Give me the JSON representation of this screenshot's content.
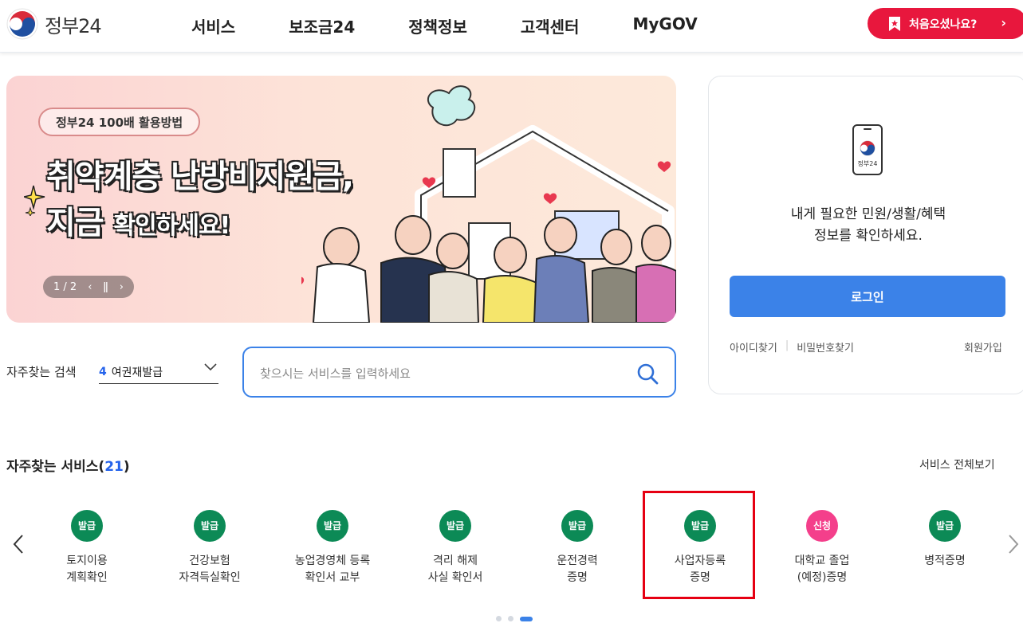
{
  "header": {
    "logo_text": "정부24",
    "nav": [
      "서비스",
      "보조금24",
      "정책정보",
      "고객센터",
      "MyGOV"
    ],
    "cta_label": "처음오셨나요?"
  },
  "banner": {
    "tag": "정부24 100배 활용방법",
    "title_line1": "취약계층 난방비지원금,",
    "title_line2_a": "지금",
    "title_line2_b": "확인하세요!",
    "pager": "1 / 2"
  },
  "login": {
    "phone_label": "정부24",
    "message_line1": "내게 필요한 민원/생활/혜택",
    "message_line2": "정보를 확인하세요.",
    "button": "로그인",
    "find_id": "아이디찾기",
    "find_pw": "비밀번호찾기",
    "signup": "회원가입"
  },
  "search": {
    "label": "자주찾는 검색",
    "selected_num": "4",
    "selected_text": "여권재발급",
    "placeholder": "찾으시는 서비스를 입력하세요"
  },
  "services": {
    "title": "자주찾는 서비스",
    "count": "21",
    "more": "서비스 전체보기",
    "items": [
      {
        "badge": "발급",
        "name": "토지이용\n계획확인"
      },
      {
        "badge": "발급",
        "name": "건강보험\n자격득실확인"
      },
      {
        "badge": "발급",
        "name": "농업경영체 등록\n확인서 교부"
      },
      {
        "badge": "발급",
        "name": "격리 해제\n사실 확인서"
      },
      {
        "badge": "발급",
        "name": "운전경력\n증명"
      },
      {
        "badge": "발급",
        "name": "사업자등록\n증명"
      },
      {
        "badge": "신청",
        "name": "대학교 졸업\n(예정)증명"
      },
      {
        "badge": "발급",
        "name": "병적증명"
      }
    ]
  },
  "colors": {
    "brand_blue": "#3b82e8",
    "cta_red": "#e8173d",
    "badge_green": "#0c8a56",
    "badge_pink": "#f43f8b",
    "highlight_red": "#e60012"
  }
}
